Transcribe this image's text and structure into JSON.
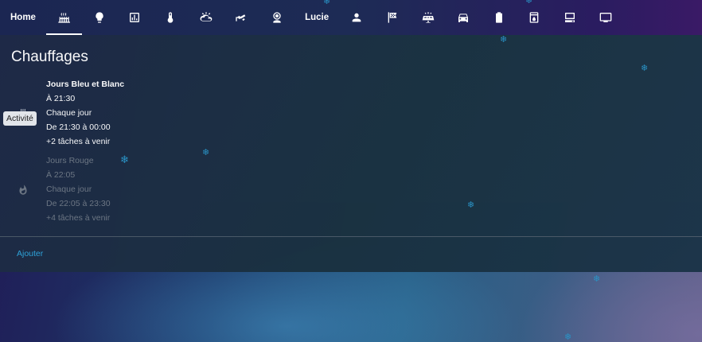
{
  "nav": {
    "tabs": [
      {
        "kind": "text",
        "label": "Home",
        "name": "tab-home"
      },
      {
        "kind": "icon",
        "icon": "radiator-icon",
        "name": "tab-heating",
        "active": true
      },
      {
        "kind": "icon",
        "icon": "lightbulb-icon",
        "name": "tab-lights"
      },
      {
        "kind": "icon",
        "icon": "chart-icon",
        "name": "tab-charts"
      },
      {
        "kind": "icon",
        "icon": "thermometer-icon",
        "name": "tab-temperature"
      },
      {
        "kind": "icon",
        "icon": "weather-icon",
        "name": "tab-weather"
      },
      {
        "kind": "icon",
        "icon": "cctv-icon",
        "name": "tab-cameras"
      },
      {
        "kind": "icon",
        "icon": "webcam-icon",
        "name": "tab-webcam"
      },
      {
        "kind": "text",
        "label": "Lucie",
        "name": "tab-lucie"
      },
      {
        "kind": "icon",
        "icon": "person-icon",
        "name": "tab-person"
      },
      {
        "kind": "icon",
        "icon": "checkered-flag-icon",
        "name": "tab-flag"
      },
      {
        "kind": "icon",
        "icon": "solar-panel-icon",
        "name": "tab-solar"
      },
      {
        "kind": "icon",
        "icon": "car-icon",
        "name": "tab-car"
      },
      {
        "kind": "icon",
        "icon": "battery-icon",
        "name": "tab-battery"
      },
      {
        "kind": "icon",
        "icon": "water-heater-icon",
        "name": "tab-water-heater"
      },
      {
        "kind": "icon",
        "icon": "desktop-tower-icon",
        "name": "tab-computer"
      },
      {
        "kind": "icon",
        "icon": "television-icon",
        "name": "tab-tv"
      }
    ]
  },
  "card": {
    "title": "Chauffages",
    "tooltip": "Activité",
    "entries": [
      {
        "name": "Jours Bleu et Blanc",
        "time": "À 21:30",
        "repeat": "Chaque jour",
        "range": "De 21:30 à 00:00",
        "more": "+2 tâches à venir",
        "active": true
      },
      {
        "name": "Jours Rouge",
        "time": "À 22:05",
        "repeat": "Chaque jour",
        "range": "De 22:05 à 23:30",
        "more": "+4 tâches à venir",
        "active": false
      }
    ],
    "add_label": "Ajouter"
  },
  "colors": {
    "accent": "#2fa6dc",
    "inactive_text": "#6f7985",
    "snowflake": "#2a93c6"
  }
}
